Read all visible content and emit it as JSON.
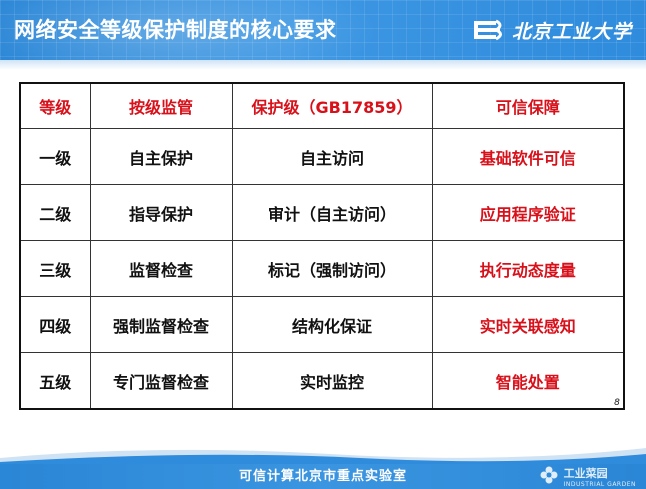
{
  "header": {
    "title": "网络安全等级保护制度的核心要求",
    "logo_text": "北京工业大学",
    "logo_icon": "bjut-logo-icon"
  },
  "table": {
    "headers": [
      "等级",
      "按级监管",
      "保护级（GB17859）",
      "可信保障"
    ],
    "rows": [
      [
        "一级",
        "自主保护",
        "自主访问",
        "基础软件可信"
      ],
      [
        "二级",
        "指导保护",
        "审计（自主访问）",
        "应用程序验证"
      ],
      [
        "三级",
        "监督检查",
        "标记（强制访问）",
        "执行动态度量"
      ],
      [
        "四级",
        "强制监督检查",
        "结构化保证",
        "实时关联感知"
      ],
      [
        "五级",
        "专门监督检查",
        "实时监控",
        "智能处置"
      ]
    ]
  },
  "page_number": "8",
  "footer": {
    "text": "可信计算北京市重点实验室",
    "watermark_text": "工业菜园",
    "watermark_sub": "INDUSTRIAL GARDEN",
    "watermark_icon": "flower-icon"
  },
  "colors": {
    "header_blue": "#2f8bdc",
    "accent_red": "#d8101a"
  }
}
